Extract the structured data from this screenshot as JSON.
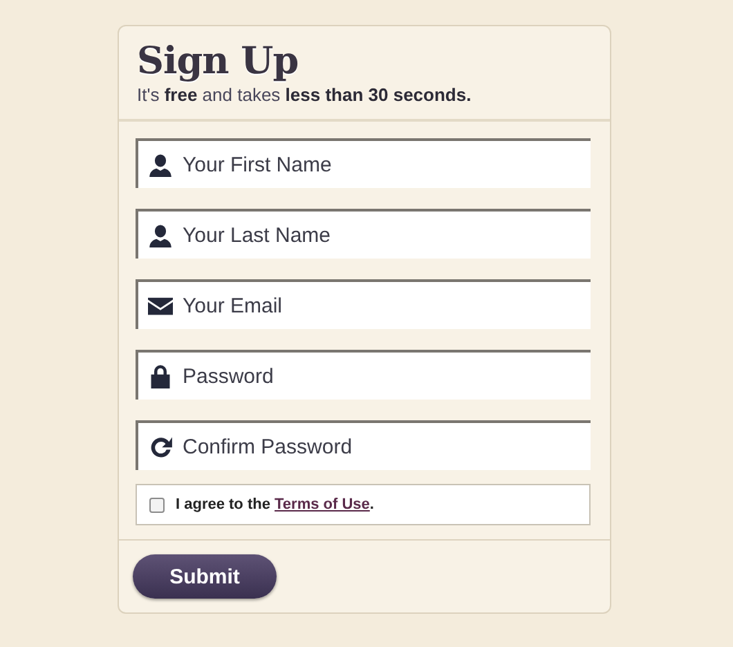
{
  "form": {
    "title": "Sign Up",
    "subtitle": "It's **free** and takes **less than 30 seconds.**",
    "fields": [
      {
        "kind": "person",
        "placeholder": "Your First Name"
      },
      {
        "kind": "person",
        "placeholder": "Your Last Name"
      },
      {
        "kind": "mail",
        "placeholder": "Your Email"
      },
      {
        "kind": "lock",
        "placeholder": "Password"
      },
      {
        "kind": "refresh",
        "placeholder": "Confirm Password"
      }
    ],
    "agreement": {
      "checked": false,
      "text_before": "I agree to the",
      "link": "Terms of Use",
      "text_after": "."
    },
    "submit": "Submit"
  }
}
